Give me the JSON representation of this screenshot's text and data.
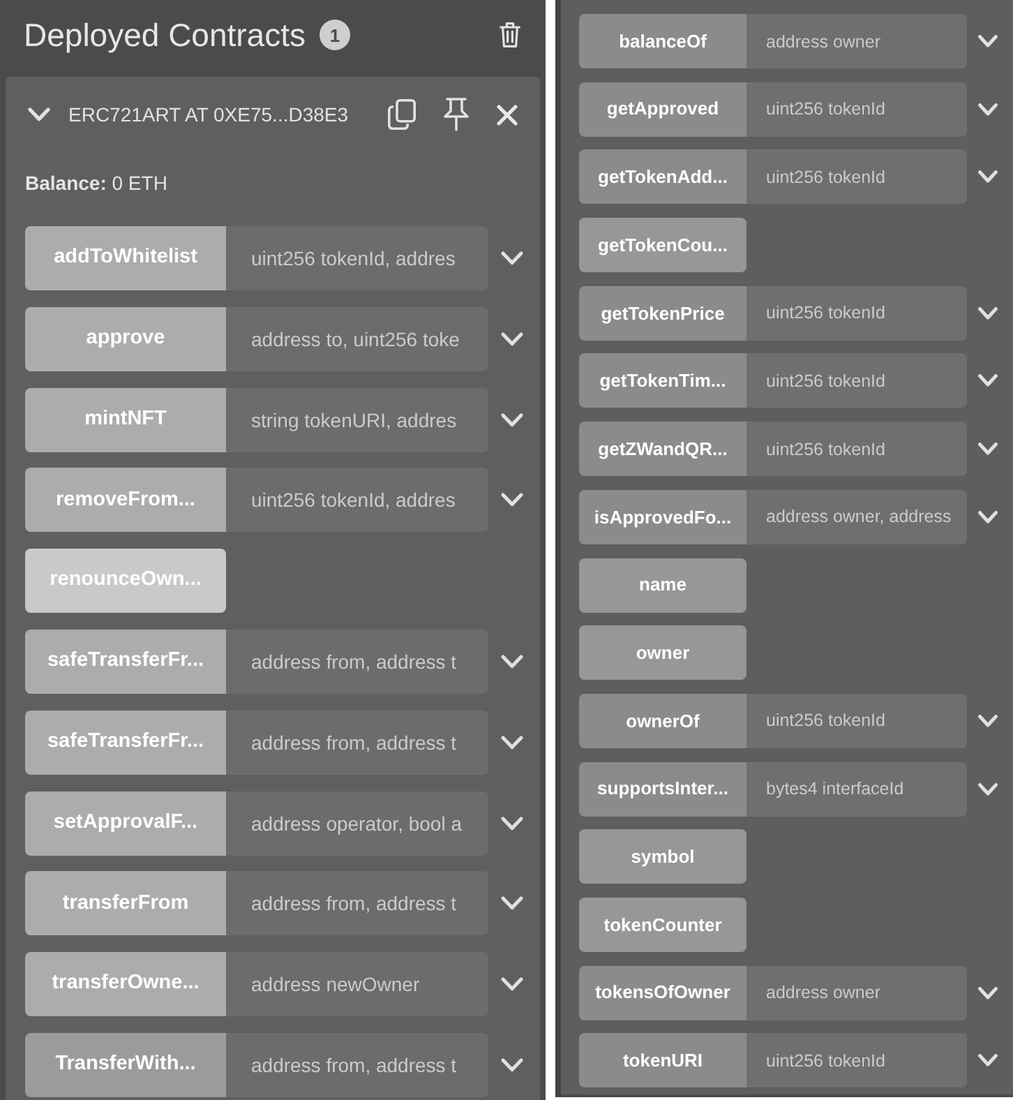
{
  "left_panel": {
    "header": {
      "title": "Deployed Contracts",
      "count": "1"
    },
    "contract": {
      "title": "ERC721ART AT 0XE75...D38E3",
      "expanded": true,
      "balance": "**Balance:** 0 ETH",
      "functions": [
        {
          "name": "addToWhitelist",
          "kind": "transact",
          "placeholder": "uint256 tokenId, addres"
        },
        {
          "name": "approve",
          "kind": "transact",
          "placeholder": "address to, uint256 toke"
        },
        {
          "name": "mintNFT",
          "kind": "transact",
          "placeholder": "string tokenURI, addres"
        },
        {
          "name": "removeFrom...",
          "kind": "transact",
          "placeholder": "uint256 tokenId, addres"
        },
        {
          "name": "renounceOwn...",
          "kind": "transact"
        },
        {
          "name": "safeTransferFr...",
          "kind": "transact",
          "placeholder": "address from, address t"
        },
        {
          "name": "safeTransferFr...",
          "kind": "transact",
          "placeholder": "address from, address t"
        },
        {
          "name": "setApprovalF...",
          "kind": "transact",
          "placeholder": "address operator, bool a"
        },
        {
          "name": "transferFrom",
          "kind": "transact",
          "placeholder": "address from, address t"
        },
        {
          "name": "transferOwne...",
          "kind": "transact",
          "placeholder": "address newOwner"
        },
        {
          "name": "TransferWith...",
          "kind": "payable",
          "placeholder": "address from, address t"
        }
      ]
    }
  },
  "right_panel": {
    "functions": [
      {
        "name": "balanceOf",
        "kind": "call",
        "placeholder": "address owner"
      },
      {
        "name": "getApproved",
        "kind": "call",
        "placeholder": "uint256 tokenId"
      },
      {
        "name": "getTokenAdd...",
        "kind": "call",
        "placeholder": "uint256 tokenId"
      },
      {
        "name": "getTokenCou...",
        "kind": "call"
      },
      {
        "name": "getTokenPrice",
        "kind": "call",
        "placeholder": "uint256 tokenId"
      },
      {
        "name": "getTokenTim...",
        "kind": "call",
        "placeholder": "uint256 tokenId"
      },
      {
        "name": "getZWandQR...",
        "kind": "call",
        "placeholder": "uint256 tokenId"
      },
      {
        "name": "isApprovedFo...",
        "kind": "call",
        "placeholder": "address owner, address"
      },
      {
        "name": "name",
        "kind": "call"
      },
      {
        "name": "owner",
        "kind": "call"
      },
      {
        "name": "ownerOf",
        "kind": "call",
        "placeholder": "uint256 tokenId"
      },
      {
        "name": "supportsInter...",
        "kind": "call",
        "placeholder": "bytes4 interfaceId"
      },
      {
        "name": "symbol",
        "kind": "call"
      },
      {
        "name": "tokenCounter",
        "kind": "call"
      },
      {
        "name": "tokensOfOwner",
        "kind": "call",
        "placeholder": "address owner"
      },
      {
        "name": "tokenURI",
        "kind": "call",
        "placeholder": "uint256 tokenId"
      }
    ]
  }
}
